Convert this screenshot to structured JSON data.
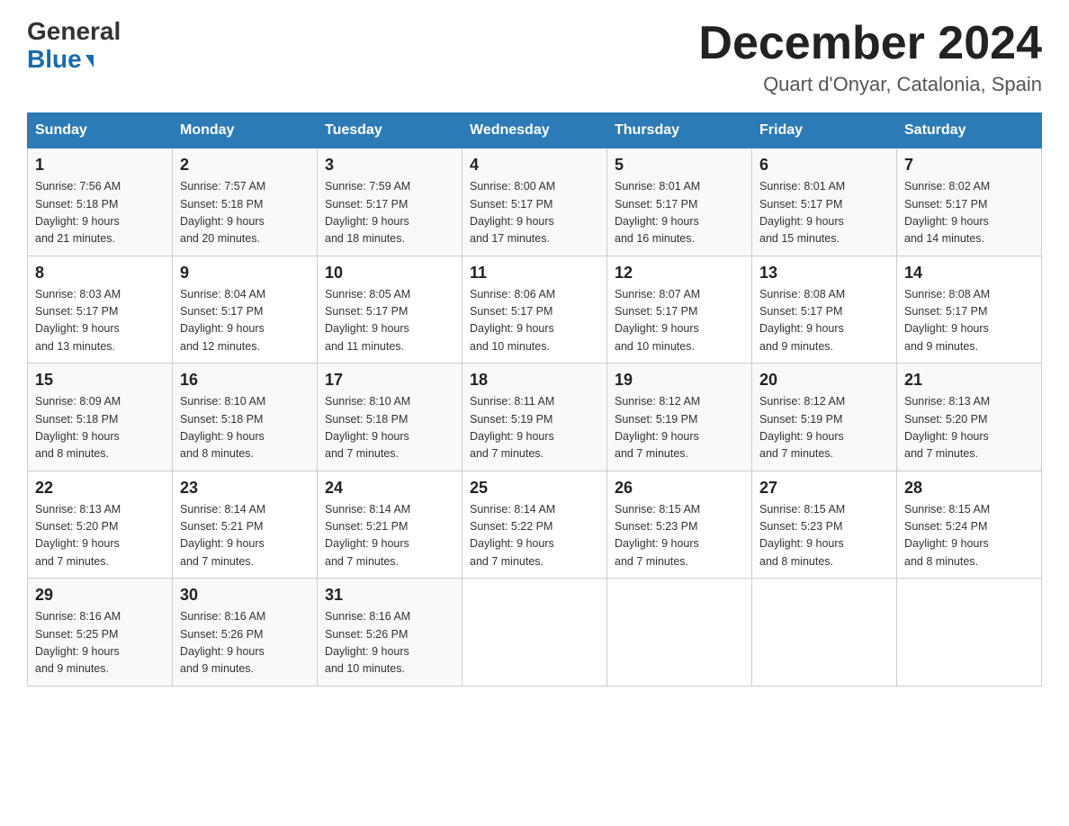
{
  "header": {
    "logo_general": "General",
    "logo_blue": "Blue",
    "title": "December 2024",
    "subtitle": "Quart d'Onyar, Catalonia, Spain"
  },
  "columns": [
    "Sunday",
    "Monday",
    "Tuesday",
    "Wednesday",
    "Thursday",
    "Friday",
    "Saturday"
  ],
  "weeks": [
    [
      {
        "day": "1",
        "sunrise": "7:56 AM",
        "sunset": "5:18 PM",
        "daylight": "9 hours and 21 minutes."
      },
      {
        "day": "2",
        "sunrise": "7:57 AM",
        "sunset": "5:18 PM",
        "daylight": "9 hours and 20 minutes."
      },
      {
        "day": "3",
        "sunrise": "7:59 AM",
        "sunset": "5:17 PM",
        "daylight": "9 hours and 18 minutes."
      },
      {
        "day": "4",
        "sunrise": "8:00 AM",
        "sunset": "5:17 PM",
        "daylight": "9 hours and 17 minutes."
      },
      {
        "day": "5",
        "sunrise": "8:01 AM",
        "sunset": "5:17 PM",
        "daylight": "9 hours and 16 minutes."
      },
      {
        "day": "6",
        "sunrise": "8:01 AM",
        "sunset": "5:17 PM",
        "daylight": "9 hours and 15 minutes."
      },
      {
        "day": "7",
        "sunrise": "8:02 AM",
        "sunset": "5:17 PM",
        "daylight": "9 hours and 14 minutes."
      }
    ],
    [
      {
        "day": "8",
        "sunrise": "8:03 AM",
        "sunset": "5:17 PM",
        "daylight": "9 hours and 13 minutes."
      },
      {
        "day": "9",
        "sunrise": "8:04 AM",
        "sunset": "5:17 PM",
        "daylight": "9 hours and 12 minutes."
      },
      {
        "day": "10",
        "sunrise": "8:05 AM",
        "sunset": "5:17 PM",
        "daylight": "9 hours and 11 minutes."
      },
      {
        "day": "11",
        "sunrise": "8:06 AM",
        "sunset": "5:17 PM",
        "daylight": "9 hours and 10 minutes."
      },
      {
        "day": "12",
        "sunrise": "8:07 AM",
        "sunset": "5:17 PM",
        "daylight": "9 hours and 10 minutes."
      },
      {
        "day": "13",
        "sunrise": "8:08 AM",
        "sunset": "5:17 PM",
        "daylight": "9 hours and 9 minutes."
      },
      {
        "day": "14",
        "sunrise": "8:08 AM",
        "sunset": "5:17 PM",
        "daylight": "9 hours and 9 minutes."
      }
    ],
    [
      {
        "day": "15",
        "sunrise": "8:09 AM",
        "sunset": "5:18 PM",
        "daylight": "9 hours and 8 minutes."
      },
      {
        "day": "16",
        "sunrise": "8:10 AM",
        "sunset": "5:18 PM",
        "daylight": "9 hours and 8 minutes."
      },
      {
        "day": "17",
        "sunrise": "8:10 AM",
        "sunset": "5:18 PM",
        "daylight": "9 hours and 7 minutes."
      },
      {
        "day": "18",
        "sunrise": "8:11 AM",
        "sunset": "5:19 PM",
        "daylight": "9 hours and 7 minutes."
      },
      {
        "day": "19",
        "sunrise": "8:12 AM",
        "sunset": "5:19 PM",
        "daylight": "9 hours and 7 minutes."
      },
      {
        "day": "20",
        "sunrise": "8:12 AM",
        "sunset": "5:19 PM",
        "daylight": "9 hours and 7 minutes."
      },
      {
        "day": "21",
        "sunrise": "8:13 AM",
        "sunset": "5:20 PM",
        "daylight": "9 hours and 7 minutes."
      }
    ],
    [
      {
        "day": "22",
        "sunrise": "8:13 AM",
        "sunset": "5:20 PM",
        "daylight": "9 hours and 7 minutes."
      },
      {
        "day": "23",
        "sunrise": "8:14 AM",
        "sunset": "5:21 PM",
        "daylight": "9 hours and 7 minutes."
      },
      {
        "day": "24",
        "sunrise": "8:14 AM",
        "sunset": "5:21 PM",
        "daylight": "9 hours and 7 minutes."
      },
      {
        "day": "25",
        "sunrise": "8:14 AM",
        "sunset": "5:22 PM",
        "daylight": "9 hours and 7 minutes."
      },
      {
        "day": "26",
        "sunrise": "8:15 AM",
        "sunset": "5:23 PM",
        "daylight": "9 hours and 7 minutes."
      },
      {
        "day": "27",
        "sunrise": "8:15 AM",
        "sunset": "5:23 PM",
        "daylight": "9 hours and 8 minutes."
      },
      {
        "day": "28",
        "sunrise": "8:15 AM",
        "sunset": "5:24 PM",
        "daylight": "9 hours and 8 minutes."
      }
    ],
    [
      {
        "day": "29",
        "sunrise": "8:16 AM",
        "sunset": "5:25 PM",
        "daylight": "9 hours and 9 minutes."
      },
      {
        "day": "30",
        "sunrise": "8:16 AM",
        "sunset": "5:26 PM",
        "daylight": "9 hours and 9 minutes."
      },
      {
        "day": "31",
        "sunrise": "8:16 AM",
        "sunset": "5:26 PM",
        "daylight": "9 hours and 10 minutes."
      },
      null,
      null,
      null,
      null
    ]
  ],
  "labels": {
    "sunrise_prefix": "Sunrise: ",
    "sunset_prefix": "Sunset: ",
    "daylight_prefix": "Daylight: "
  }
}
